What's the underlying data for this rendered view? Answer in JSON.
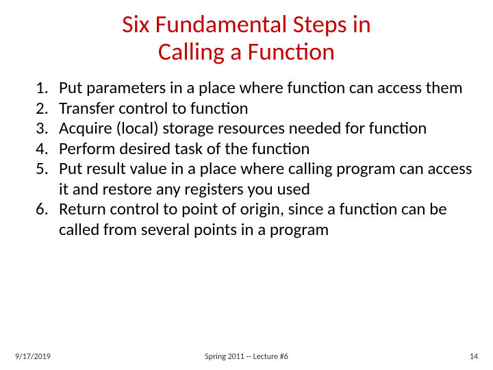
{
  "title_line1": "Six Fundamental Steps in",
  "title_line2": "Calling a Function",
  "steps": [
    "Put parameters in a place where function can access them",
    "Transfer control to function",
    "Acquire (local) storage resources needed for function",
    "Perform desired task of the function",
    "Put result value in a place where calling program can access it and restore any registers you used",
    "Return control to point of origin, since a function can be called from several points in a program"
  ],
  "footer": {
    "date": "9/17/2019",
    "center": "Spring 2011 -- Lecture #6",
    "page": "14"
  }
}
